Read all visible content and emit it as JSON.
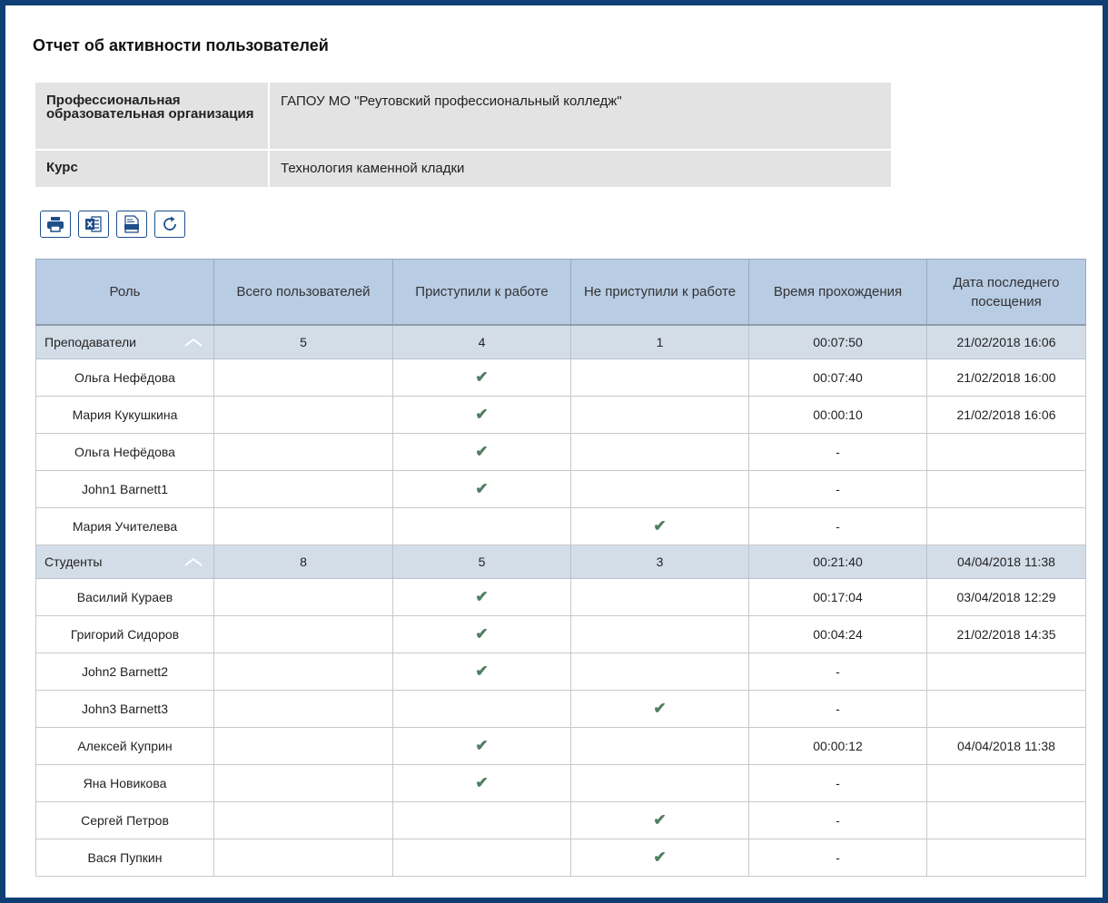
{
  "title": "Отчет об активности пользователей",
  "info": {
    "org_label": "Профессиональная образовательная организация",
    "org_value": "ГАПОУ МО \"Реутовский профессиональный колледж\"",
    "course_label": "Курс",
    "course_value": "Технология каменной кладки"
  },
  "toolbar": [
    "printer-icon",
    "excel-icon",
    "pdf-icon",
    "refresh-icon"
  ],
  "columns": [
    "Роль",
    "Всего пользователей",
    "Приступили к работе",
    "Не приступили к работе",
    "Время прохождения",
    "Дата последнего посещения"
  ],
  "groups": [
    {
      "name": "Преподаватели",
      "total": "5",
      "started": "4",
      "not_started": "1",
      "time": "00:07:50",
      "last_visit": "21/02/2018 16:06",
      "users": [
        {
          "name": "Ольга Нефёдова",
          "started": true,
          "not_started": false,
          "time": "00:07:40",
          "last_visit": "21/02/2018 16:00"
        },
        {
          "name": "Мария Кукушкина",
          "started": true,
          "not_started": false,
          "time": "00:00:10",
          "last_visit": "21/02/2018 16:06"
        },
        {
          "name": "Ольга Нефёдова",
          "started": true,
          "not_started": false,
          "time": "-",
          "last_visit": ""
        },
        {
          "name": "John1 Barnett1",
          "started": true,
          "not_started": false,
          "time": "-",
          "last_visit": ""
        },
        {
          "name": "Мария Учителева",
          "started": false,
          "not_started": true,
          "time": "-",
          "last_visit": ""
        }
      ]
    },
    {
      "name": "Студенты",
      "total": "8",
      "started": "5",
      "not_started": "3",
      "time": "00:21:40",
      "last_visit": "04/04/2018 11:38",
      "users": [
        {
          "name": "Василий Кураев",
          "started": true,
          "not_started": false,
          "time": "00:17:04",
          "last_visit": "03/04/2018 12:29"
        },
        {
          "name": "Григорий Сидоров",
          "started": true,
          "not_started": false,
          "time": "00:04:24",
          "last_visit": "21/02/2018 14:35"
        },
        {
          "name": "John2 Barnett2",
          "started": true,
          "not_started": false,
          "time": "-",
          "last_visit": ""
        },
        {
          "name": "John3 Barnett3",
          "started": false,
          "not_started": true,
          "time": "-",
          "last_visit": ""
        },
        {
          "name": "Алексей Куприн",
          "started": true,
          "not_started": false,
          "time": "00:00:12",
          "last_visit": "04/04/2018 11:38"
        },
        {
          "name": "Яна Новикова",
          "started": true,
          "not_started": false,
          "time": "-",
          "last_visit": ""
        },
        {
          "name": "Сергей Петров",
          "started": false,
          "not_started": true,
          "time": "-",
          "last_visit": ""
        },
        {
          "name": "Вася Пупкин",
          "started": false,
          "not_started": true,
          "time": "-",
          "last_visit": ""
        }
      ]
    }
  ],
  "check_glyph": "✔",
  "colors": {
    "frame": "#0f3f75",
    "header_bg": "#b8cce4",
    "group_bg": "#d3dde8",
    "check": "#4f7f61",
    "info_bg": "#e3e3e3"
  }
}
